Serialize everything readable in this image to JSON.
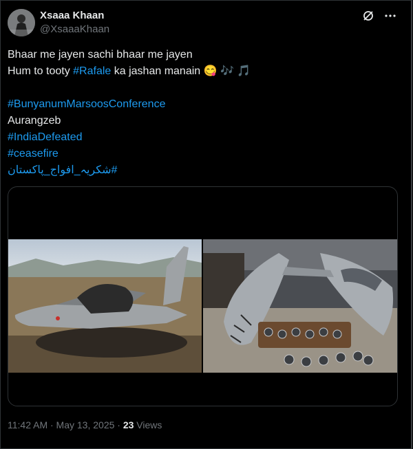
{
  "author": {
    "name": "Xsaaa Khaan",
    "handle": "@XsaaaKhaan"
  },
  "icons": {
    "top_left": "grok-icon",
    "top_right": "more-icon"
  },
  "tweet": {
    "line1": "Bhaar me jayen sachi bhaar me jayen",
    "line2_pre": "Hum to tooty ",
    "line2_tag": "#Rafale",
    "line2_post": " ka jashan manain 😋 🎶 🎵",
    "tag1": "#BunyanumMarsoosConference",
    "plain": "Aurangzeb",
    "tag2": "#IndiaDefeated",
    "tag3": "#ceasefire",
    "tag4": "#شکریہ_افواج_پاکستان"
  },
  "footer": {
    "time": "11:42 AM · May 13, 2025 · ",
    "views_count": "23",
    "views_label": " Views"
  },
  "colors": {
    "link": "#1d9bf0",
    "muted": "#71767b",
    "text": "#e7e9ea"
  }
}
